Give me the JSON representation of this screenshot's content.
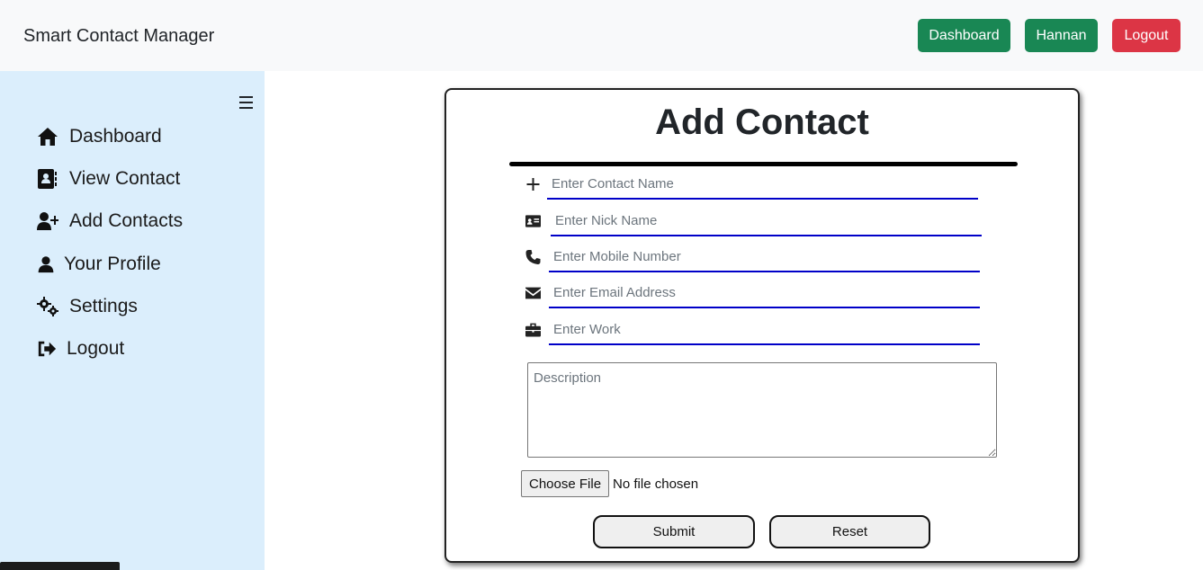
{
  "navbar": {
    "brand": "Smart Contact Manager",
    "dashboard_label": "Dashboard",
    "user_label": "Hannan",
    "logout_label": "Logout"
  },
  "sidebar": {
    "items": [
      {
        "label": "Dashboard",
        "icon": "home-icon"
      },
      {
        "label": "View Contact",
        "icon": "address-book-icon"
      },
      {
        "label": "Add Contacts",
        "icon": "user-plus-icon"
      },
      {
        "label": "Your Profile",
        "icon": "user-icon"
      },
      {
        "label": "Settings",
        "icon": "gears-icon"
      },
      {
        "label": "Logout",
        "icon": "sign-out-icon"
      }
    ]
  },
  "form": {
    "title": "Add Contact",
    "fields": [
      {
        "placeholder": "Enter Contact Name",
        "icon": "plus-icon"
      },
      {
        "placeholder": "Enter Nick Name",
        "icon": "id-card-icon"
      },
      {
        "placeholder": "Enter Mobile Number",
        "icon": "phone-icon"
      },
      {
        "placeholder": "Enter Email Address",
        "icon": "envelope-icon"
      },
      {
        "placeholder": "Enter Work",
        "icon": "briefcase-icon"
      }
    ],
    "description_placeholder": "Description",
    "file_button": "Choose File",
    "file_status": "No file chosen",
    "submit_label": "Submit",
    "reset_label": "Reset"
  },
  "colors": {
    "navbar_bg": "#f8f9fa",
    "sidebar_bg": "#dbeefc",
    "success": "#198754",
    "danger": "#dc3545",
    "input_underline": "#0000c8"
  }
}
